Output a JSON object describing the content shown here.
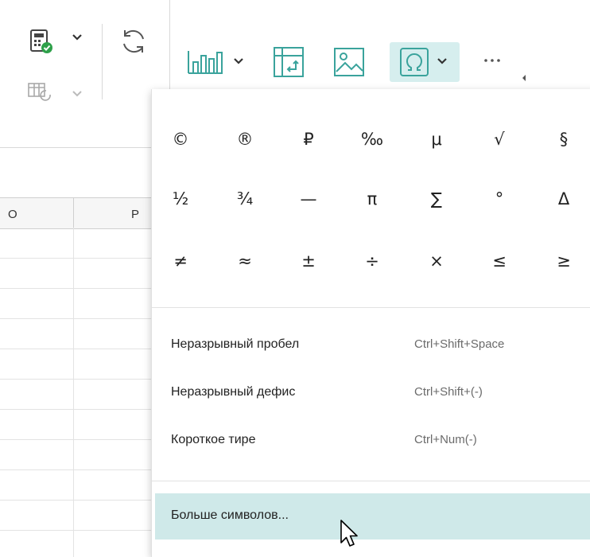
{
  "colors": {
    "accent_teal": "#3aa39c",
    "highlight": "#cfe9e9",
    "green_check": "#2ea04a"
  },
  "toolbar": {
    "icons": [
      "calculator-check-icon",
      "chevron-down-icon",
      "calc-recalc-icon",
      "chevron-down-icon",
      "refresh-icon",
      "bar-chart-icon",
      "chevron-down-icon",
      "pivot-table-icon",
      "image-icon",
      "omega-symbol-icon",
      "chevron-down-icon",
      "more-icon"
    ]
  },
  "grid": {
    "columns": [
      "O",
      "P"
    ]
  },
  "symbols": {
    "row1": [
      "©",
      "®",
      "₽",
      "‰",
      "μ",
      "√",
      "§"
    ],
    "row2": [
      "½",
      "¾",
      "—",
      "π",
      "∑",
      "°",
      "Δ"
    ],
    "row3": [
      "≠",
      "≈",
      "±",
      "÷",
      "×",
      "≤",
      "≥"
    ]
  },
  "menu_items": [
    {
      "label": "Неразрывный пробел",
      "shortcut": "Ctrl+Shift+Space"
    },
    {
      "label": "Неразрывный дефис",
      "shortcut": "Ctrl+Shift+(-)"
    },
    {
      "label": "Короткое тире",
      "shortcut": "Ctrl+Num(-)"
    }
  ],
  "more_symbols_label": "Больше символов..."
}
